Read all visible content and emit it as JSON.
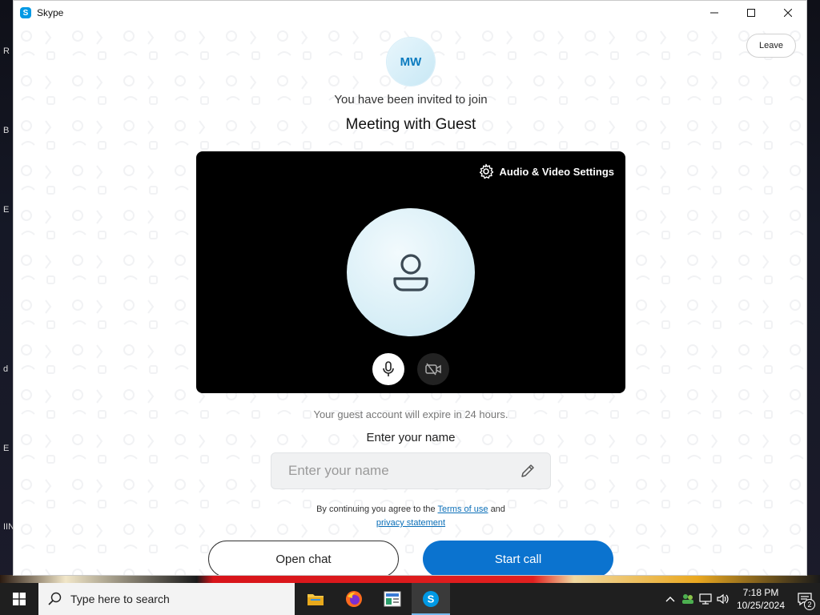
{
  "window": {
    "title": "Skype",
    "app_icon_letter": "S"
  },
  "desktop": {
    "edge_labels": [
      "R",
      "B",
      "E",
      "d",
      "E",
      "IIN"
    ]
  },
  "meeting": {
    "leave_label": "Leave",
    "avatar_initials": "MW",
    "invite_text": "You have been invited to join",
    "title": "Meeting with Guest",
    "av_settings_label": "Audio & Video Settings",
    "expire_text": "Your guest account will expire in 24 hours.",
    "name_label": "Enter your name",
    "name_placeholder": "Enter your name",
    "name_value": "",
    "terms_prefix": "By continuing you agree to the",
    "terms_link": "Terms of use",
    "terms_and": "and",
    "privacy_link": "privacy statement",
    "open_chat_label": "Open chat",
    "start_call_label": "Start call"
  },
  "taskbar": {
    "search_placeholder": "Type here to search",
    "apps": [
      "file-explorer-icon",
      "firefox-icon",
      "news-app-icon",
      "skype-icon"
    ],
    "time": "7:18 PM",
    "date": "10/25/2024",
    "notification_count": "2"
  },
  "colors": {
    "accent": "#0b73cf",
    "link": "#0b6fb8",
    "skype_blue": "#0099e5"
  }
}
